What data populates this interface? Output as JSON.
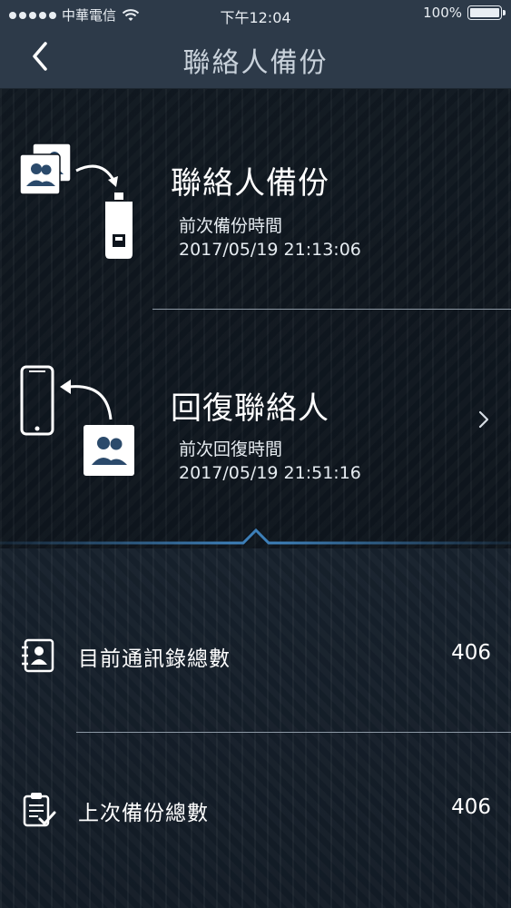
{
  "status_bar": {
    "carrier": "中華電信",
    "time": "下午12:04",
    "battery": "100%"
  },
  "nav": {
    "title": "聯絡人備份"
  },
  "backup": {
    "title": "聯絡人備份",
    "sub_label": "前次備份時間",
    "timestamp": "2017/05/19 21:13:06"
  },
  "restore": {
    "title": "回復聯絡人",
    "sub_label": "前次回復時間",
    "timestamp": "2017/05/19 21:51:16"
  },
  "stats": [
    {
      "label": "目前通訊錄總數",
      "value": "406",
      "icon": "contact-card-icon"
    },
    {
      "label": "上次備份總數",
      "value": "406",
      "icon": "clipboard-check-icon"
    }
  ],
  "colors": {
    "nav_bg": "#2d3a49",
    "accent_blue": "#3d7fb8",
    "divider": "#8c98a4"
  }
}
